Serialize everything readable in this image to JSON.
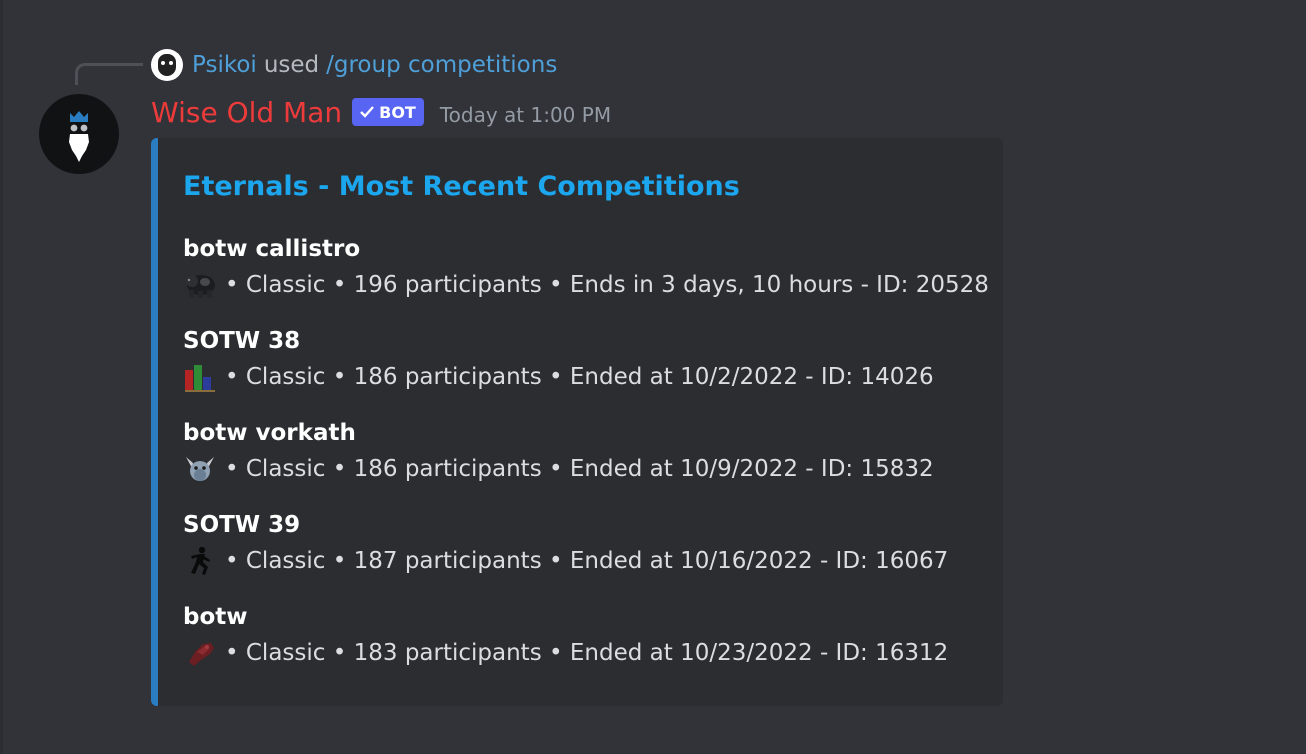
{
  "reply": {
    "username": "Psikoi",
    "used_text": "used",
    "command": "/group competitions"
  },
  "message": {
    "author": "Wise Old Man",
    "bot_tag": "BOT",
    "timestamp": "Today at 1:00 PM"
  },
  "embed": {
    "accent_color": "#2b7dc2",
    "title": "Eternals - Most Recent Competitions",
    "competitions": [
      {
        "name": "botw callistro",
        "icon": "callisto-boss-icon",
        "info": "• Classic • 196 participants • Ends in 3 days, 10 hours - ID: 20528"
      },
      {
        "name": "SOTW 38",
        "icon": "overall-stats-icon",
        "info": "• Classic • 186 participants • Ended at 10/2/2022 - ID: 14026"
      },
      {
        "name": "botw vorkath",
        "icon": "vorkath-boss-icon",
        "info": "• Classic • 186 participants • Ended at 10/9/2022 - ID: 15832"
      },
      {
        "name": "SOTW 39",
        "icon": "agility-icon",
        "info": "• Classic • 187 participants • Ended at 10/16/2022 - ID: 16067"
      },
      {
        "name": "botw",
        "icon": "boss-hand-icon",
        "info": "• Classic • 183 participants • Ended at 10/23/2022 - ID: 16312"
      }
    ]
  },
  "colors": {
    "background": "#313338",
    "embed_background": "#2b2d31",
    "author": "#ed3b3b",
    "link": "#4f9fd9",
    "title": "#1ca6ee",
    "bot_tag": "#5865f2"
  }
}
